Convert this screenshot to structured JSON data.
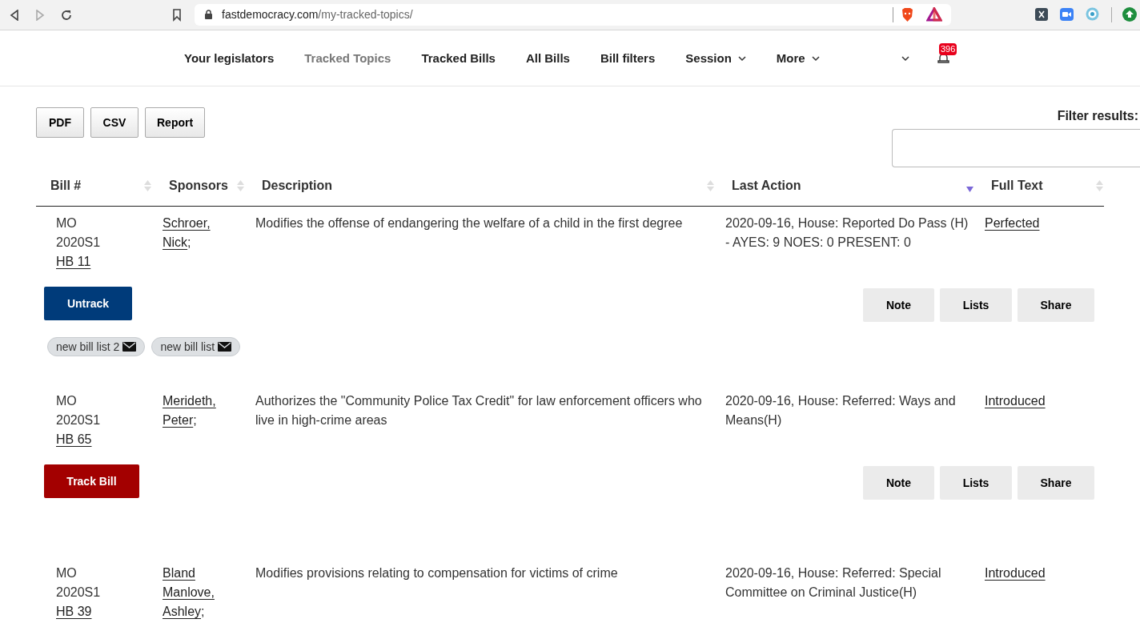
{
  "browser": {
    "url_host": "fastdemocracy.com",
    "url_path": "/my-tracked-topics/"
  },
  "nav": {
    "items": [
      {
        "label": "Your legislators",
        "selected": false,
        "dropdown": false
      },
      {
        "label": "Tracked Topics",
        "selected": true,
        "dropdown": false
      },
      {
        "label": "Tracked Bills",
        "selected": false,
        "dropdown": false
      },
      {
        "label": "All Bills",
        "selected": false,
        "dropdown": false
      },
      {
        "label": "Bill filters",
        "selected": false,
        "dropdown": false
      },
      {
        "label": "Session",
        "selected": false,
        "dropdown": true
      },
      {
        "label": "More",
        "selected": false,
        "dropdown": true
      }
    ],
    "notifications": "396"
  },
  "export_buttons": [
    "PDF",
    "CSV",
    "Report"
  ],
  "filter": {
    "label": "Filter results:"
  },
  "table": {
    "columns": [
      {
        "label": "Bill #",
        "sorted": false
      },
      {
        "label": "Sponsors",
        "sorted": false
      },
      {
        "label": "Description",
        "sorted": false
      },
      {
        "label": "Last Action",
        "sorted": true
      },
      {
        "label": "Full Text",
        "sorted": false
      }
    ],
    "rows": [
      {
        "state": "MO",
        "session": "2020S1",
        "bill": "HB 11",
        "sponsors": [
          {
            "lines": [
              "Schroer,",
              "Nick"
            ],
            "sep": ";"
          }
        ],
        "description": "Modifies the offense of endangering the welfare of a child in the first degree",
        "last_action": "2020-09-16, House: Reported Do Pass (H) - AYES: 9 NOES: 0 PRESENT: 0",
        "full_text": "Perfected",
        "tracked": true,
        "track_button": "Untrack",
        "actions": [
          "Note",
          "Lists",
          "Share"
        ],
        "lists": [
          "new bill list 2",
          "new bill list"
        ]
      },
      {
        "state": "MO",
        "session": "2020S1",
        "bill": "HB 65",
        "sponsors": [
          {
            "lines": [
              "Merideth,",
              "Peter"
            ],
            "sep": ";"
          }
        ],
        "description": "Authorizes the \"Community Police Tax Credit\" for law enforcement officers who live in high-crime areas",
        "last_action": "2020-09-16, House: Referred: Ways and Means(H)",
        "full_text": "Introduced",
        "tracked": false,
        "track_button": "Track Bill",
        "actions": [
          "Note",
          "Lists",
          "Share"
        ]
      },
      {
        "state": "MO",
        "session": "2020S1",
        "bill": "HB 39",
        "sponsors": [
          {
            "lines": [
              "Bland",
              "Manlove,",
              "Ashley"
            ],
            "sep": ";"
          }
        ],
        "description": "Modifies provisions relating to compensation for victims of crime",
        "last_action": "2020-09-16, House: Referred: Special Committee on Criminal Justice(H)",
        "full_text": "Introduced"
      }
    ]
  }
}
